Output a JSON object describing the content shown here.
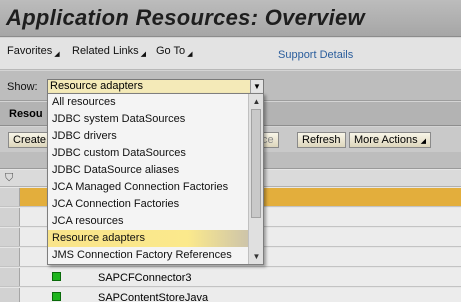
{
  "app": {
    "title": "Application Resources: Overview"
  },
  "menu": {
    "items": [
      {
        "label": "Favorites"
      },
      {
        "label": "Related Links"
      },
      {
        "label": "Go To"
      }
    ],
    "support_link": "Support Details"
  },
  "show": {
    "label": "Show:",
    "selected": "Resource adapters",
    "options": [
      "All resources",
      "JDBC system DataSources",
      "JDBC drivers",
      "JDBC custom DataSources",
      "JDBC DataSource aliases",
      "JCA Managed Connection Factories",
      "JCA Connection Factories",
      "JCA resources",
      "Resource adapters",
      "JMS Connection Factory References"
    ]
  },
  "panel": {
    "title_partial": "Resou"
  },
  "toolbar": {
    "create_label": "Create",
    "hidden_partial": "ce",
    "refresh_label": "Refresh",
    "more_actions_label": "More Actions"
  },
  "table": {
    "rows": [
      {
        "name": "SAPCFConnector3",
        "status": "green"
      },
      {
        "name": "SAPContentStoreJava",
        "status": "green"
      }
    ]
  },
  "colors": {
    "selected_row": "#e3ae3c",
    "status_ok": "#1fb51f",
    "select_bg": "#f4eab8"
  },
  "icons": {
    "dropdown": "chevron-down-icon",
    "filter": "filter-icon",
    "menu": "triangle-down-icon"
  }
}
